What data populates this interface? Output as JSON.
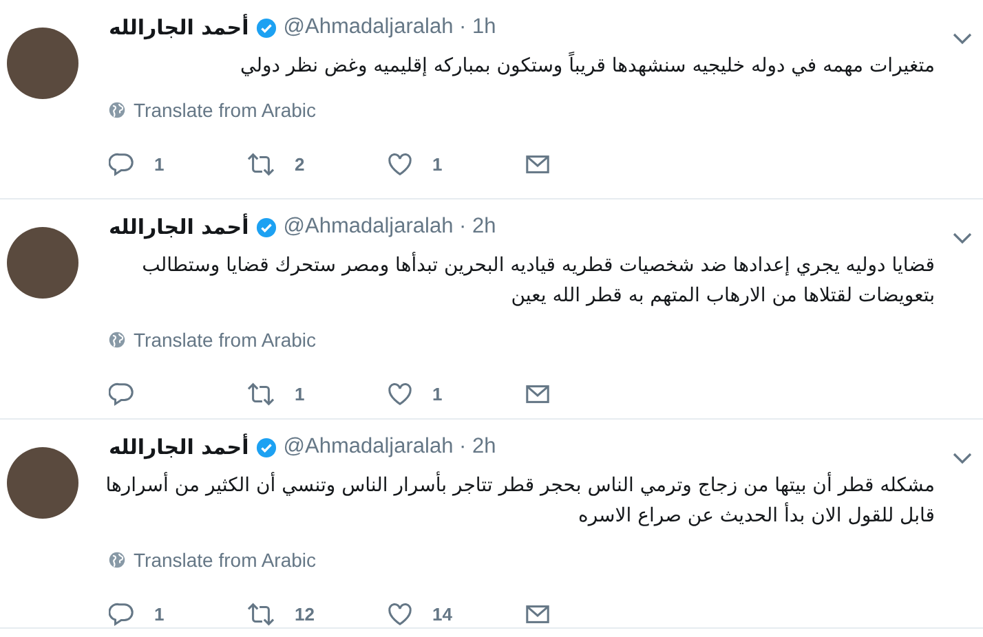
{
  "tweets": [
    {
      "name": "أحمد الجارالله",
      "verified": true,
      "meta": "@Ahmadaljaralah · 1h",
      "lines": [
        "متغيرات مهمه في دوله خليجيه سنشهدها قريباً وستكون بمباركه إقليميه وغض نظر دولي"
      ],
      "translate": "Translate from Arabic",
      "reply_count": "1",
      "retweet_count": "2",
      "like_count": "1"
    },
    {
      "name": "أحمد الجارالله",
      "verified": true,
      "meta": "@Ahmadaljaralah · 2h",
      "lines": [
        "قضايا دوليه يجري إعدادها ضد شخصيات قطريه قياديه البحرين تبدأها ومصر ستحرك قضايا وستطالب",
        "بتعويضات لقتلاها من الارهاب المتهم به قطر الله يعين"
      ],
      "translate": "Translate from Arabic",
      "retweet_count": "1",
      "like_count": "1"
    },
    {
      "name": "أحمد الجارالله",
      "verified": true,
      "meta": "@Ahmadaljaralah · 2h",
      "lines": [
        "مشكله قطر أن بيتها من زجاج وترمي الناس بحجر قطر تتاجر بأسرار الناس وتنسي أن الكثير من أسرارها",
        "قابل للقول الان بدأ الحديث عن صراع الاسره"
      ],
      "translate": "Translate from Arabic",
      "reply_count": "1",
      "retweet_count": "12",
      "like_count": "14"
    }
  ]
}
